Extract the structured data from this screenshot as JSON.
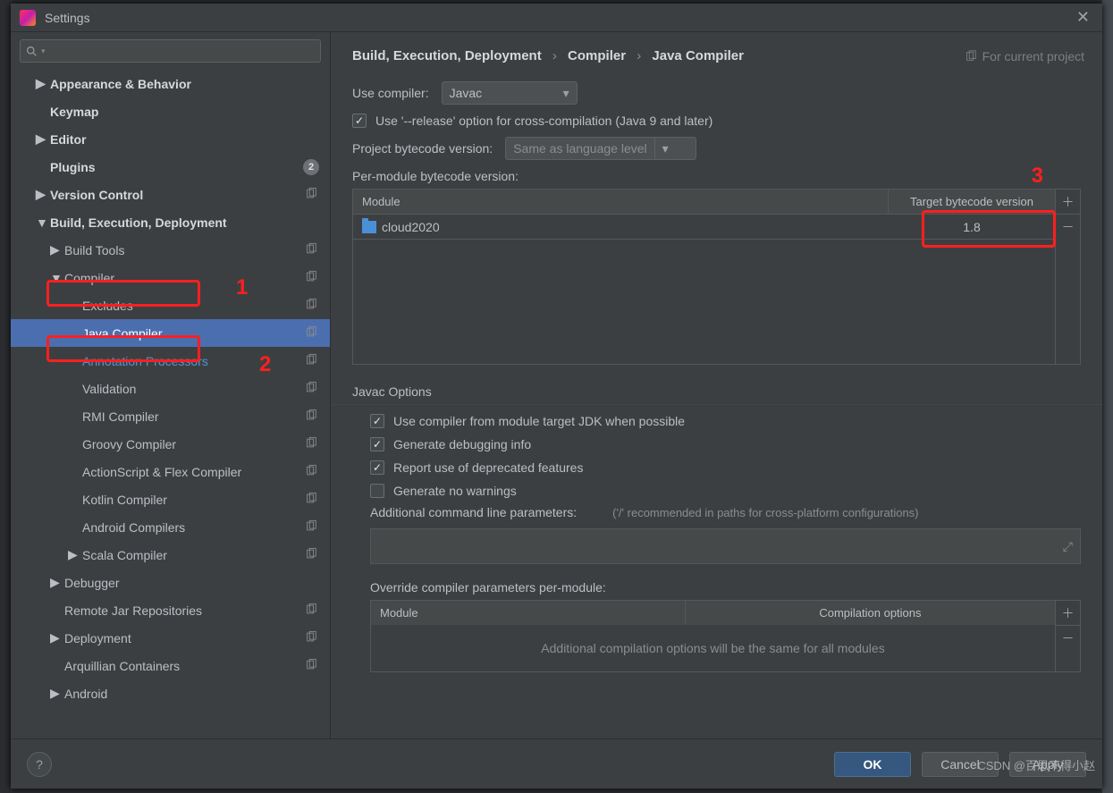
{
  "window": {
    "title": "Settings"
  },
  "search": {
    "placeholder": ""
  },
  "tree": {
    "items": [
      {
        "label": "Appearance & Behavior",
        "bold": true,
        "expand": "▶"
      },
      {
        "label": "Keymap",
        "bold": true
      },
      {
        "label": "Editor",
        "bold": true,
        "expand": "▶"
      },
      {
        "label": "Plugins",
        "bold": true,
        "badge": "2"
      },
      {
        "label": "Version Control",
        "bold": true,
        "expand": "▶",
        "settingsIcon": true
      },
      {
        "label": "Build, Execution, Deployment",
        "bold": true,
        "expand": "▼"
      },
      {
        "label": "Build Tools",
        "ind": 1,
        "expand": "▶",
        "settingsIcon": true
      },
      {
        "label": "Compiler",
        "ind": 1,
        "expand": "▼",
        "settingsIcon": true
      },
      {
        "label": "Excludes",
        "ind": 2,
        "settingsIcon": true
      },
      {
        "label": "Java Compiler",
        "ind": 2,
        "selected": true,
        "settingsIcon": true
      },
      {
        "label": "Annotation Processors",
        "ind": 2,
        "activeLink": true,
        "settingsIcon": true
      },
      {
        "label": "Validation",
        "ind": 2,
        "settingsIcon": true
      },
      {
        "label": "RMI Compiler",
        "ind": 2,
        "settingsIcon": true
      },
      {
        "label": "Groovy Compiler",
        "ind": 2,
        "settingsIcon": true
      },
      {
        "label": "ActionScript & Flex Compiler",
        "ind": 2,
        "settingsIcon": true
      },
      {
        "label": "Kotlin Compiler",
        "ind": 2,
        "settingsIcon": true
      },
      {
        "label": "Android Compilers",
        "ind": 2,
        "settingsIcon": true
      },
      {
        "label": "Scala Compiler",
        "ind": 2,
        "expand": "▶",
        "settingsIcon": true
      },
      {
        "label": "Debugger",
        "ind": 1,
        "expand": "▶"
      },
      {
        "label": "Remote Jar Repositories",
        "ind": 1,
        "settingsIcon": true
      },
      {
        "label": "Deployment",
        "ind": 1,
        "expand": "▶",
        "settingsIcon": true
      },
      {
        "label": "Arquillian Containers",
        "ind": 1,
        "settingsIcon": true
      },
      {
        "label": "Android",
        "ind": 1,
        "expand": "▶"
      }
    ]
  },
  "breadcrumbs": {
    "a": "Build, Execution, Deployment",
    "b": "Compiler",
    "c": "Java Compiler",
    "sep": "›"
  },
  "scope": {
    "label": "For current project"
  },
  "form": {
    "use_compiler_label": "Use compiler:",
    "use_compiler_value": "Javac",
    "release_opt": "Use '--release' option for cross-compilation (Java 9 and later)",
    "project_bc_label": "Project bytecode version:",
    "project_bc_value": "Same as language level",
    "per_module_label": "Per-module bytecode version:",
    "th_module": "Module",
    "th_target": "Target bytecode version",
    "row_module": "cloud2020",
    "row_target": "1.8",
    "javac_options_title": "Javac Options",
    "cb1": "Use compiler from module target JDK when possible",
    "cb2": "Generate debugging info",
    "cb3": "Report use of deprecated features",
    "cb4": "Generate no warnings",
    "add_params_label": "Additional command line parameters:",
    "add_params_hint": "('/' recommended in paths for cross-platform configurations)",
    "override_label": "Override compiler parameters per-module:",
    "th2_module": "Module",
    "th2_opts": "Compilation options",
    "placeholder_row": "Additional compilation options will be the same for all modules"
  },
  "footer": {
    "ok": "OK",
    "cancel": "Cancel",
    "apply": "Apply",
    "help": "?"
  },
  "annot": {
    "n1": "1",
    "n2": "2",
    "n3": "3"
  },
  "watermark": "CSDN @百思不得小赵"
}
